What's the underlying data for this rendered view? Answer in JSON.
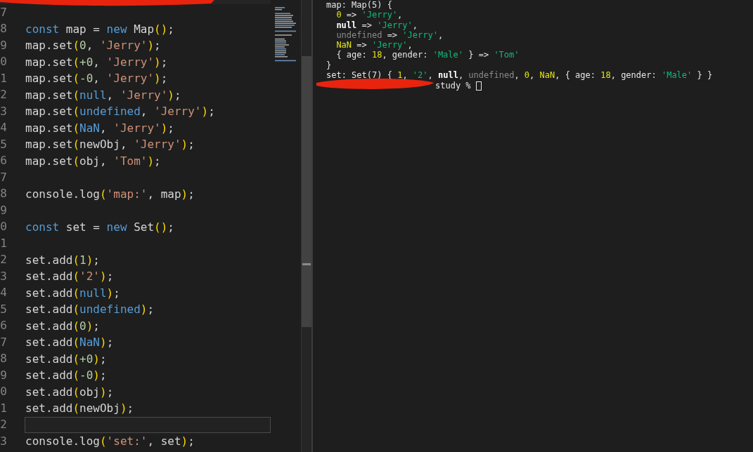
{
  "editor": {
    "lines": [
      {
        "number": "7",
        "current": false
      },
      {
        "number": "8",
        "current": false,
        "tokens": [
          {
            "kind": "keyword",
            "text": "const"
          },
          {
            "kind": "plain",
            "text": " map = "
          },
          {
            "kind": "keyword",
            "text": "new"
          },
          {
            "kind": "plain",
            "text": " Map"
          },
          {
            "kind": "paren",
            "text": "()"
          },
          {
            "kind": "plain",
            "text": ";"
          }
        ]
      },
      {
        "number": "9",
        "current": false,
        "tokens": [
          {
            "kind": "plain",
            "text": "map.set"
          },
          {
            "kind": "paren",
            "text": "("
          },
          {
            "kind": "number",
            "text": "0"
          },
          {
            "kind": "plain",
            "text": ", "
          },
          {
            "kind": "string",
            "text": "'Jerry'"
          },
          {
            "kind": "paren",
            "text": ")"
          },
          {
            "kind": "plain",
            "text": ";"
          }
        ]
      },
      {
        "number": "0",
        "current": false,
        "tokens": [
          {
            "kind": "plain",
            "text": "map.set"
          },
          {
            "kind": "paren",
            "text": "("
          },
          {
            "kind": "number",
            "text": "+0"
          },
          {
            "kind": "plain",
            "text": ", "
          },
          {
            "kind": "string",
            "text": "'Jerry'"
          },
          {
            "kind": "paren",
            "text": ")"
          },
          {
            "kind": "plain",
            "text": ";"
          }
        ]
      },
      {
        "number": "1",
        "current": false,
        "tokens": [
          {
            "kind": "plain",
            "text": "map.set"
          },
          {
            "kind": "paren",
            "text": "("
          },
          {
            "kind": "number",
            "text": "-0"
          },
          {
            "kind": "plain",
            "text": ", "
          },
          {
            "kind": "string",
            "text": "'Jerry'"
          },
          {
            "kind": "paren",
            "text": ")"
          },
          {
            "kind": "plain",
            "text": ";"
          }
        ]
      },
      {
        "number": "2",
        "current": false,
        "tokens": [
          {
            "kind": "plain",
            "text": "map.set"
          },
          {
            "kind": "paren",
            "text": "("
          },
          {
            "kind": "constant",
            "text": "null"
          },
          {
            "kind": "plain",
            "text": ", "
          },
          {
            "kind": "string",
            "text": "'Jerry'"
          },
          {
            "kind": "paren",
            "text": ")"
          },
          {
            "kind": "plain",
            "text": ";"
          }
        ]
      },
      {
        "number": "3",
        "current": false,
        "tokens": [
          {
            "kind": "plain",
            "text": "map.set"
          },
          {
            "kind": "paren",
            "text": "("
          },
          {
            "kind": "constant",
            "text": "undefined"
          },
          {
            "kind": "plain",
            "text": ", "
          },
          {
            "kind": "string",
            "text": "'Jerry'"
          },
          {
            "kind": "paren",
            "text": ")"
          },
          {
            "kind": "plain",
            "text": ";"
          }
        ]
      },
      {
        "number": "4",
        "current": false,
        "tokens": [
          {
            "kind": "plain",
            "text": "map.set"
          },
          {
            "kind": "paren",
            "text": "("
          },
          {
            "kind": "constant",
            "text": "NaN"
          },
          {
            "kind": "plain",
            "text": ", "
          },
          {
            "kind": "string",
            "text": "'Jerry'"
          },
          {
            "kind": "paren",
            "text": ")"
          },
          {
            "kind": "plain",
            "text": ";"
          }
        ]
      },
      {
        "number": "5",
        "current": false,
        "tokens": [
          {
            "kind": "plain",
            "text": "map.set"
          },
          {
            "kind": "paren",
            "text": "("
          },
          {
            "kind": "plain",
            "text": "newObj, "
          },
          {
            "kind": "string",
            "text": "'Jerry'"
          },
          {
            "kind": "paren",
            "text": ")"
          },
          {
            "kind": "plain",
            "text": ";"
          }
        ]
      },
      {
        "number": "6",
        "current": false,
        "tokens": [
          {
            "kind": "plain",
            "text": "map.set"
          },
          {
            "kind": "paren",
            "text": "("
          },
          {
            "kind": "plain",
            "text": "obj, "
          },
          {
            "kind": "string",
            "text": "'Tom'"
          },
          {
            "kind": "paren",
            "text": ")"
          },
          {
            "kind": "plain",
            "text": ";"
          }
        ]
      },
      {
        "number": "7",
        "current": false
      },
      {
        "number": "8",
        "current": false,
        "tokens": [
          {
            "kind": "plain",
            "text": "console.log"
          },
          {
            "kind": "paren",
            "text": "("
          },
          {
            "kind": "string",
            "text": "'map:'"
          },
          {
            "kind": "plain",
            "text": ", map"
          },
          {
            "kind": "paren",
            "text": ")"
          },
          {
            "kind": "plain",
            "text": ";"
          }
        ]
      },
      {
        "number": "9",
        "current": false
      },
      {
        "number": "0",
        "current": false,
        "tokens": [
          {
            "kind": "keyword",
            "text": "const"
          },
          {
            "kind": "plain",
            "text": " set = "
          },
          {
            "kind": "keyword",
            "text": "new"
          },
          {
            "kind": "plain",
            "text": " Set"
          },
          {
            "kind": "paren",
            "text": "()"
          },
          {
            "kind": "plain",
            "text": ";"
          }
        ]
      },
      {
        "number": "1",
        "current": false
      },
      {
        "number": "2",
        "current": false,
        "tokens": [
          {
            "kind": "plain",
            "text": "set.add"
          },
          {
            "kind": "paren",
            "text": "("
          },
          {
            "kind": "number",
            "text": "1"
          },
          {
            "kind": "paren",
            "text": ")"
          },
          {
            "kind": "plain",
            "text": ";"
          }
        ]
      },
      {
        "number": "3",
        "current": false,
        "tokens": [
          {
            "kind": "plain",
            "text": "set.add"
          },
          {
            "kind": "paren",
            "text": "("
          },
          {
            "kind": "string",
            "text": "'2'"
          },
          {
            "kind": "paren",
            "text": ")"
          },
          {
            "kind": "plain",
            "text": ";"
          }
        ]
      },
      {
        "number": "4",
        "current": false,
        "tokens": [
          {
            "kind": "plain",
            "text": "set.add"
          },
          {
            "kind": "paren",
            "text": "("
          },
          {
            "kind": "constant",
            "text": "null"
          },
          {
            "kind": "paren",
            "text": ")"
          },
          {
            "kind": "plain",
            "text": ";"
          }
        ]
      },
      {
        "number": "5",
        "current": false,
        "tokens": [
          {
            "kind": "plain",
            "text": "set.add"
          },
          {
            "kind": "paren",
            "text": "("
          },
          {
            "kind": "constant",
            "text": "undefined"
          },
          {
            "kind": "paren",
            "text": ")"
          },
          {
            "kind": "plain",
            "text": ";"
          }
        ]
      },
      {
        "number": "6",
        "current": false,
        "tokens": [
          {
            "kind": "plain",
            "text": "set.add"
          },
          {
            "kind": "paren",
            "text": "("
          },
          {
            "kind": "number",
            "text": "0"
          },
          {
            "kind": "paren",
            "text": ")"
          },
          {
            "kind": "plain",
            "text": ";"
          }
        ]
      },
      {
        "number": "7",
        "current": false,
        "tokens": [
          {
            "kind": "plain",
            "text": "set.add"
          },
          {
            "kind": "paren",
            "text": "("
          },
          {
            "kind": "constant",
            "text": "NaN"
          },
          {
            "kind": "paren",
            "text": ")"
          },
          {
            "kind": "plain",
            "text": ";"
          }
        ]
      },
      {
        "number": "8",
        "current": false,
        "tokens": [
          {
            "kind": "plain",
            "text": "set.add"
          },
          {
            "kind": "paren",
            "text": "("
          },
          {
            "kind": "number",
            "text": "+0"
          },
          {
            "kind": "paren",
            "text": ")"
          },
          {
            "kind": "plain",
            "text": ";"
          }
        ]
      },
      {
        "number": "9",
        "current": false,
        "tokens": [
          {
            "kind": "plain",
            "text": "set.add"
          },
          {
            "kind": "paren",
            "text": "("
          },
          {
            "kind": "number",
            "text": "-0"
          },
          {
            "kind": "paren",
            "text": ")"
          },
          {
            "kind": "plain",
            "text": ";"
          }
        ]
      },
      {
        "number": "0",
        "current": false,
        "tokens": [
          {
            "kind": "plain",
            "text": "set.add"
          },
          {
            "kind": "paren",
            "text": "("
          },
          {
            "kind": "plain",
            "text": "obj"
          },
          {
            "kind": "paren",
            "text": ")"
          },
          {
            "kind": "plain",
            "text": ";"
          }
        ]
      },
      {
        "number": "1",
        "current": false,
        "tokens": [
          {
            "kind": "plain",
            "text": "set.add"
          },
          {
            "kind": "paren",
            "text": "("
          },
          {
            "kind": "plain",
            "text": "newObj"
          },
          {
            "kind": "paren",
            "text": ")"
          },
          {
            "kind": "plain",
            "text": ";"
          }
        ]
      },
      {
        "number": "2",
        "current": true
      },
      {
        "number": "3",
        "current": false,
        "tokens": [
          {
            "kind": "plain",
            "text": "console.log"
          },
          {
            "kind": "paren",
            "text": "("
          },
          {
            "kind": "string",
            "text": "'set:'"
          },
          {
            "kind": "plain",
            "text": ", set"
          },
          {
            "kind": "paren",
            "text": ")"
          },
          {
            "kind": "plain",
            "text": ";"
          }
        ]
      }
    ]
  },
  "terminal": {
    "lines": [
      [
        {
          "kind": "plain",
          "text": "map: Map(5) {"
        }
      ],
      [
        {
          "kind": "indent"
        },
        {
          "kind": "number",
          "text": "0"
        },
        {
          "kind": "plain",
          "text": " => "
        },
        {
          "kind": "string",
          "text": "'Jerry'"
        },
        {
          "kind": "plain",
          "text": ","
        }
      ],
      [
        {
          "kind": "indent"
        },
        {
          "kind": "null",
          "text": "null"
        },
        {
          "kind": "plain",
          "text": " => "
        },
        {
          "kind": "string",
          "text": "'Jerry'"
        },
        {
          "kind": "plain",
          "text": ","
        }
      ],
      [
        {
          "kind": "indent"
        },
        {
          "kind": "undefined",
          "text": "undefined"
        },
        {
          "kind": "plain",
          "text": " => "
        },
        {
          "kind": "string",
          "text": "'Jerry'"
        },
        {
          "kind": "plain",
          "text": ","
        }
      ],
      [
        {
          "kind": "indent"
        },
        {
          "kind": "number",
          "text": "NaN"
        },
        {
          "kind": "plain",
          "text": " => "
        },
        {
          "kind": "string",
          "text": "'Jerry'"
        },
        {
          "kind": "plain",
          "text": ","
        }
      ],
      [
        {
          "kind": "indent"
        },
        {
          "kind": "plain",
          "text": "{ age: "
        },
        {
          "kind": "number",
          "text": "18"
        },
        {
          "kind": "plain",
          "text": ", gender: "
        },
        {
          "kind": "string",
          "text": "'Male'"
        },
        {
          "kind": "plain",
          "text": " } => "
        },
        {
          "kind": "string",
          "text": "'Tom'"
        }
      ],
      [
        {
          "kind": "plain",
          "text": "}"
        }
      ],
      [
        {
          "kind": "plain",
          "text": "set: Set(7) { "
        },
        {
          "kind": "number",
          "text": "1"
        },
        {
          "kind": "plain",
          "text": ", "
        },
        {
          "kind": "string",
          "text": "'2'"
        },
        {
          "kind": "plain",
          "text": ", "
        },
        {
          "kind": "null",
          "text": "null"
        },
        {
          "kind": "plain",
          "text": ", "
        },
        {
          "kind": "undefined",
          "text": "undefined"
        },
        {
          "kind": "plain",
          "text": ", "
        },
        {
          "kind": "number",
          "text": "0"
        },
        {
          "kind": "plain",
          "text": ", "
        },
        {
          "kind": "number",
          "text": "NaN"
        },
        {
          "kind": "plain",
          "text": ", { age: "
        },
        {
          "kind": "number",
          "text": "18"
        },
        {
          "kind": "plain",
          "text": ", gender: "
        },
        {
          "kind": "string",
          "text": "'Male'"
        },
        {
          "kind": "plain",
          "text": " } }"
        }
      ]
    ],
    "prompt": "study %"
  }
}
